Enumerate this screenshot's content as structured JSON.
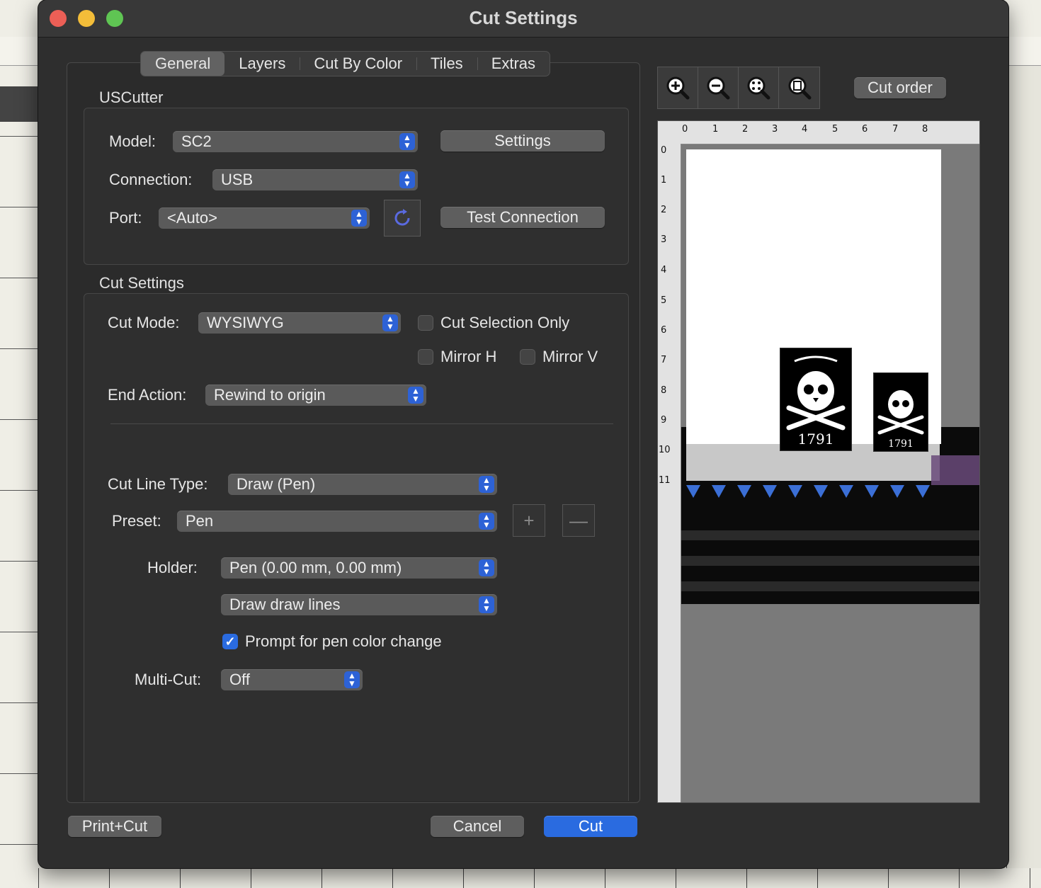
{
  "window": {
    "title": "Cut Settings"
  },
  "tabs": [
    {
      "label": "General",
      "active": true
    },
    {
      "label": "Layers",
      "active": false
    },
    {
      "label": "Cut By Color",
      "active": false
    },
    {
      "label": "Tiles",
      "active": false
    },
    {
      "label": "Extras",
      "active": false
    }
  ],
  "uscutter": {
    "section_title": "USCutter",
    "model_label": "Model:",
    "model_value": "SC2",
    "settings_button": "Settings",
    "connection_label": "Connection:",
    "connection_value": "USB",
    "port_label": "Port:",
    "port_value": "<Auto>",
    "test_connection_button": "Test Connection"
  },
  "cut_settings": {
    "section_title": "Cut Settings",
    "cut_mode_label": "Cut Mode:",
    "cut_mode_value": "WYSIWYG",
    "cut_selection_only": {
      "label": "Cut Selection Only",
      "checked": false
    },
    "mirror_h": {
      "label": "Mirror H",
      "checked": false
    },
    "mirror_v": {
      "label": "Mirror V",
      "checked": false
    },
    "end_action_label": "End Action:",
    "end_action_value": "Rewind to origin",
    "cut_line_type_label": "Cut Line Type:",
    "cut_line_type_value": "Draw (Pen)",
    "preset_label": "Preset:",
    "preset_value": "Pen",
    "holder_label": "Holder:",
    "holder_value": "Pen (0.00 mm, 0.00 mm)",
    "draw_mode_value": "Draw draw lines",
    "prompt_pen_color": {
      "label": "Prompt for pen color change",
      "checked": true
    },
    "multi_cut_label": "Multi-Cut:",
    "multi_cut_value": "Off"
  },
  "preview": {
    "cut_order_button": "Cut order",
    "zoom_icons": [
      "zoom-in-icon",
      "zoom-out-icon",
      "zoom-fit-icon",
      "zoom-page-icon"
    ],
    "ruler_top": [
      "0",
      "1",
      "2",
      "3",
      "4",
      "5",
      "6",
      "7",
      "8"
    ],
    "ruler_left": [
      "0",
      "1",
      "2",
      "3",
      "4",
      "5",
      "6",
      "7",
      "8",
      "9",
      "10",
      "11"
    ],
    "design_text": "1791"
  },
  "footer": {
    "print_cut_button": "Print+Cut",
    "cancel_button": "Cancel",
    "cut_button": "Cut"
  },
  "colors": {
    "accent": "#2a6be0",
    "window_bg": "#2e2e2e"
  }
}
